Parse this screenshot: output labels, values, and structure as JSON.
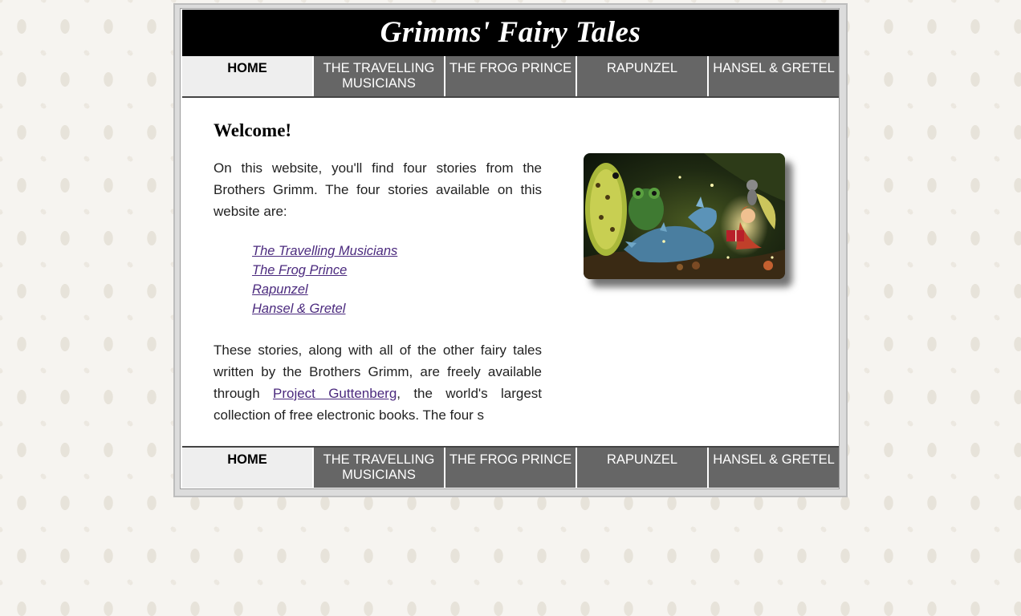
{
  "site": {
    "title": "Grimms' Fairy Tales"
  },
  "nav": {
    "items": [
      {
        "label": "HOME",
        "active": true
      },
      {
        "label": "THE TRAVELLING MUSICIANS",
        "active": false
      },
      {
        "label": "THE FROG PRINCE",
        "active": false
      },
      {
        "label": "RAPUNZEL",
        "active": false
      },
      {
        "label": "HANSEL & GRETEL",
        "active": false
      }
    ]
  },
  "main": {
    "heading": "Welcome!",
    "intro": "On this website, you'll find four stories from the Brothers Grimm. The four stories available on this website are:",
    "stories": [
      "The Travelling Musicians",
      "The Frog Prince",
      "Rapunzel",
      "Hansel & Gretel"
    ],
    "outro_before": "These stories, along with all of the other fairy tales written by the Brothers Grimm, are freely available through ",
    "outro_link": "Project Guttenberg",
    "outro_after": ", the world's largest collection of free electronic books. The four s"
  },
  "colors": {
    "banner_bg": "#000000",
    "nav_bg": "#666666",
    "nav_active_bg": "#eeeeee",
    "link": "#4b2a7e"
  }
}
